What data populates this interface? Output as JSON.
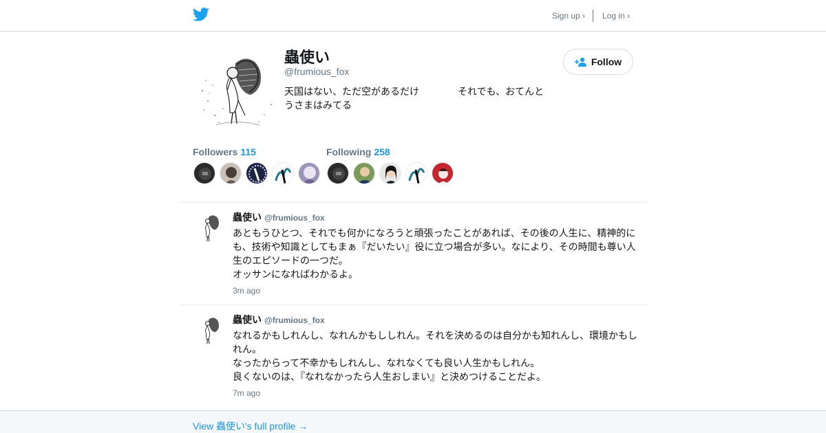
{
  "header": {
    "logo_icon": "twitter-bird-icon",
    "brand_color": "#1da1f2",
    "signup_label": "Sign up ›",
    "login_label": "Log in ›"
  },
  "profile": {
    "display_name": "蟲使い",
    "handle": "@frumious_fox",
    "bio": "天国はない、ただ空があるだけ　　　　それでも、おてんとうさまはみてる",
    "follow_label": "Follow",
    "follow_icon": "add-user-icon"
  },
  "stats": {
    "followers_label": "Followers",
    "followers_count": "115",
    "following_label": "Following",
    "following_count": "258",
    "count_color": "#1b95e0"
  },
  "tweets": [
    {
      "name": "蟲使い",
      "handle": "@frumious_fox",
      "lines": [
        "あともうひとつ、それでも何かになろうと頑張ったことがあれば、その後の人生に、精神的にも、技術や知識としてもまぁ『だいたい』役に立つ場合が多い。なにより、その時間も尊い人生のエピソードの一つだ。",
        "オッサンになればわかるよ。"
      ],
      "time": "3m ago"
    },
    {
      "name": "蟲使い",
      "handle": "@frumious_fox",
      "lines": [
        "なれるかもしれんし、なれんかもししれん。それを決めるのは自分かも知れんし、環境かもしれん。",
        "なったからって不幸かもしれんし、なれなくても良い人生かもしれん。",
        "良くないのは、『なれなかったら人生おしまい』と決めつけることだよ。"
      ],
      "time": "7m ago"
    }
  ],
  "footer": {
    "link_label": "View 蟲使い's full profile →"
  }
}
